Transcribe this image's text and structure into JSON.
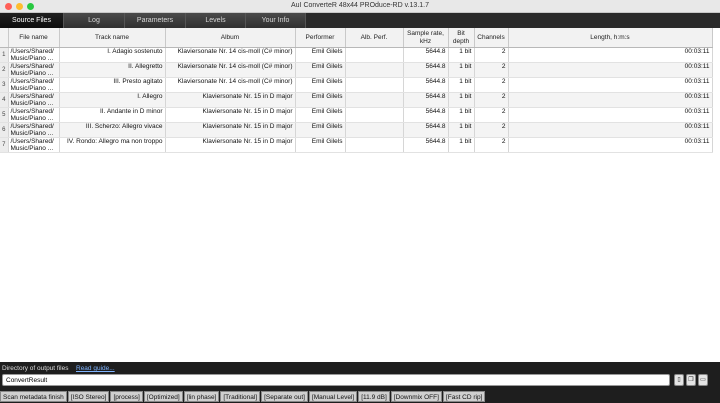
{
  "window": {
    "title": "AuI ConverteR 48x44 PROduce-RD v.13.1.7"
  },
  "tabs": [
    {
      "label": "Source Files"
    },
    {
      "label": "Log"
    },
    {
      "label": "Parameters"
    },
    {
      "label": "Levels"
    },
    {
      "label": "Your Info"
    }
  ],
  "table": {
    "headers": {
      "file_name": "File name",
      "track_name": "Track name",
      "album": "Album",
      "performer": "Performer",
      "alb_perf": "Alb. Perf.",
      "sample_rate": "Sample rate, kHz",
      "bit_depth": "Bit depth",
      "channels": "Channels",
      "length": "Length, h:m:s"
    },
    "rows": [
      {
        "num": "1",
        "file": "/Users/Shared/ Music/Piano ...",
        "track": "I. Adagio sostenuto",
        "album": "Klaviersonate Nr. 14 cis-moll (C# minor)",
        "performer": "Emil Gilels",
        "alb_perf": "",
        "rate": "5644.8",
        "bits": "1 bit",
        "channels": "2",
        "length": "00:03:11"
      },
      {
        "num": "2",
        "file": "/Users/Shared/ Music/Piano ...",
        "track": "II. Allegretto",
        "album": "Klaviersonate Nr. 14 cis-moll (C# minor)",
        "performer": "Emil Gilels",
        "alb_perf": "",
        "rate": "5644.8",
        "bits": "1 bit",
        "channels": "2",
        "length": "00:03:11"
      },
      {
        "num": "3",
        "file": "/Users/Shared/ Music/Piano ...",
        "track": "III. Presto agitato",
        "album": "Klaviersonate Nr. 14 cis-moll (C# minor)",
        "performer": "Emil Gilels",
        "alb_perf": "",
        "rate": "5644.8",
        "bits": "1 bit",
        "channels": "2",
        "length": "00:03:11"
      },
      {
        "num": "4",
        "file": "/Users/Shared/ Music/Piano ...",
        "track": "I. Allegro",
        "album": "Klaviersonate Nr. 15 in D major",
        "performer": "Emil Gilels",
        "alb_perf": "",
        "rate": "5644.8",
        "bits": "1 bit",
        "channels": "2",
        "length": "00:03:11"
      },
      {
        "num": "5",
        "file": "/Users/Shared/ Music/Piano ...",
        "track": "II. Andante in D minor",
        "album": "Klaviersonate Nr. 15 in D major",
        "performer": "Emil Gilels",
        "alb_perf": "",
        "rate": "5644.8",
        "bits": "1 bit",
        "channels": "2",
        "length": "00:03:11"
      },
      {
        "num": "6",
        "file": "/Users/Shared/ Music/Piano ...",
        "track": "III. Scherzo: Allegro vivace",
        "album": "Klaviersonate Nr. 15 in D major",
        "performer": "Emil Gilels",
        "alb_perf": "",
        "rate": "5644.8",
        "bits": "1 bit",
        "channels": "2",
        "length": "00:03:11"
      },
      {
        "num": "7",
        "file": "/Users/Shared/ Music/Piano ...",
        "track": "IV. Rondo: Allegro ma non troppo",
        "album": "Klaviersonate Nr. 15 in D major",
        "performer": "Emil Gilels",
        "alb_perf": "",
        "rate": "5644.8",
        "bits": "1 bit",
        "channels": "2",
        "length": "00:03:11"
      }
    ]
  },
  "output": {
    "label": "Directory of output files",
    "guide_link": "Read guide...",
    "value": "ConvertResult",
    "icons": [
      "file-icon",
      "copy-icon",
      "folder-icon"
    ]
  },
  "statusbar": [
    "Scan metadata finish",
    "[ISO Stereo]",
    "[process]",
    "[Optimized]",
    "[lin phase]",
    "[Traditional]",
    "[Separate out]",
    "[Manual Level]",
    "[11.9 dB]",
    "[Downmix OFF]",
    "[Fast CD rip]"
  ],
  "colors": {
    "close": "#ff5f57",
    "minimize": "#febc2e",
    "maximize": "#28c840",
    "link": "#7fb4ff"
  }
}
